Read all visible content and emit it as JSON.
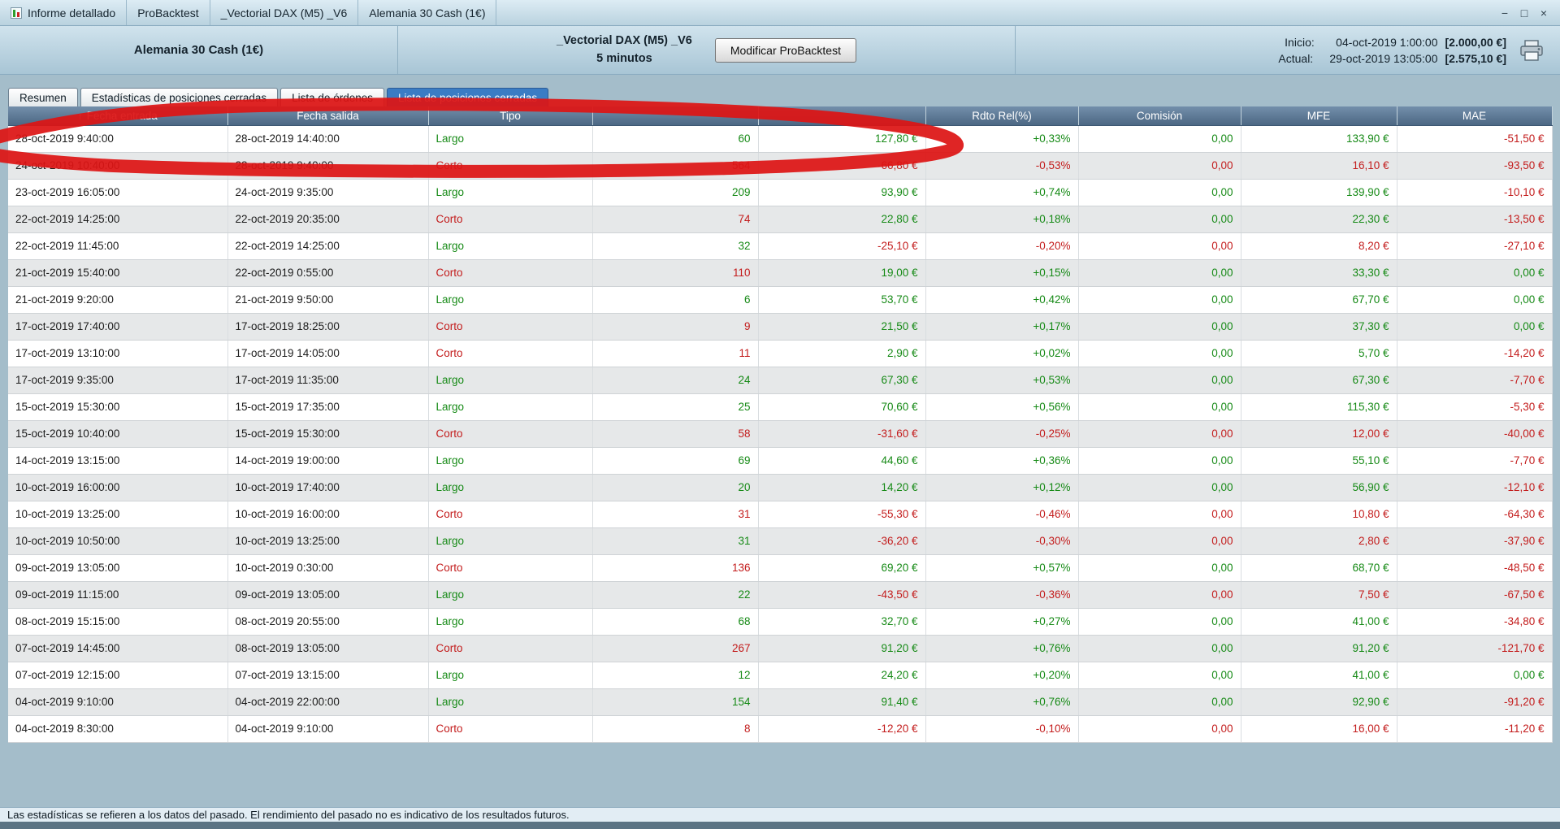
{
  "titlebar": {
    "segments": [
      "Informe detallado",
      "ProBacktest",
      "_Vectorial DAX (M5) _V6",
      "Alemania 30 Cash (1€)"
    ]
  },
  "icons": {
    "minimize": "−",
    "maximize": "□",
    "close": "×",
    "sort": "↑"
  },
  "header": {
    "instrument": "Alemania 30 Cash (1€)",
    "system": "_Vectorial DAX (M5) _V6",
    "timeframe": "5 minutos",
    "modify_button": "Modificar ProBacktest",
    "start_label": "Inicio:",
    "start_datetime": "04-oct-2019 1:00:00",
    "start_equity": "[2.000,00 €]",
    "current_label": "Actual:",
    "current_datetime": "29-oct-2019 13:05:00",
    "current_equity": "[2.575,10 €]"
  },
  "tabs": [
    {
      "label": "Resumen",
      "active": false
    },
    {
      "label": "Estadísticas de posiciones cerradas",
      "active": false
    },
    {
      "label": "Lista de órdenes",
      "active": false
    },
    {
      "label": "Lista de posiciones cerradas",
      "active": true
    }
  ],
  "table": {
    "columns": [
      "Fecha entrada",
      "Fecha salida",
      "Tipo",
      "",
      "",
      "Rdto Rel(%)",
      "Comisión",
      "MFE",
      "MAE"
    ],
    "rows": [
      [
        "28-oct-2019 9:40:00",
        "28-oct-2019 14:40:00",
        "Largo",
        "60",
        "127,80 €",
        "+0,33%",
        "0,00",
        "133,90 €",
        "-51,50 €"
      ],
      [
        "24-oct-2019 10:40:00",
        "28-oct-2019 9:40:00",
        "Corto",
        "564",
        "-66,80 €",
        "-0,53%",
        "0,00",
        "16,10 €",
        "-93,50 €"
      ],
      [
        "23-oct-2019 16:05:00",
        "24-oct-2019 9:35:00",
        "Largo",
        "209",
        "93,90 €",
        "+0,74%",
        "0,00",
        "139,90 €",
        "-10,10 €"
      ],
      [
        "22-oct-2019 14:25:00",
        "22-oct-2019 20:35:00",
        "Corto",
        "74",
        "22,80 €",
        "+0,18%",
        "0,00",
        "22,30 €",
        "-13,50 €"
      ],
      [
        "22-oct-2019 11:45:00",
        "22-oct-2019 14:25:00",
        "Largo",
        "32",
        "-25,10 €",
        "-0,20%",
        "0,00",
        "8,20 €",
        "-27,10 €"
      ],
      [
        "21-oct-2019 15:40:00",
        "22-oct-2019 0:55:00",
        "Corto",
        "110",
        "19,00 €",
        "+0,15%",
        "0,00",
        "33,30 €",
        "0,00 €"
      ],
      [
        "21-oct-2019 9:20:00",
        "21-oct-2019 9:50:00",
        "Largo",
        "6",
        "53,70 €",
        "+0,42%",
        "0,00",
        "67,70 €",
        "0,00 €"
      ],
      [
        "17-oct-2019 17:40:00",
        "17-oct-2019 18:25:00",
        "Corto",
        "9",
        "21,50 €",
        "+0,17%",
        "0,00",
        "37,30 €",
        "0,00 €"
      ],
      [
        "17-oct-2019 13:10:00",
        "17-oct-2019 14:05:00",
        "Corto",
        "11",
        "2,90 €",
        "+0,02%",
        "0,00",
        "5,70 €",
        "-14,20 €"
      ],
      [
        "17-oct-2019 9:35:00",
        "17-oct-2019 11:35:00",
        "Largo",
        "24",
        "67,30 €",
        "+0,53%",
        "0,00",
        "67,30 €",
        "-7,70 €"
      ],
      [
        "15-oct-2019 15:30:00",
        "15-oct-2019 17:35:00",
        "Largo",
        "25",
        "70,60 €",
        "+0,56%",
        "0,00",
        "115,30 €",
        "-5,30 €"
      ],
      [
        "15-oct-2019 10:40:00",
        "15-oct-2019 15:30:00",
        "Corto",
        "58",
        "-31,60 €",
        "-0,25%",
        "0,00",
        "12,00 €",
        "-40,00 €"
      ],
      [
        "14-oct-2019 13:15:00",
        "14-oct-2019 19:00:00",
        "Largo",
        "69",
        "44,60 €",
        "+0,36%",
        "0,00",
        "55,10 €",
        "-7,70 €"
      ],
      [
        "10-oct-2019 16:00:00",
        "10-oct-2019 17:40:00",
        "Largo",
        "20",
        "14,20 €",
        "+0,12%",
        "0,00",
        "56,90 €",
        "-12,10 €"
      ],
      [
        "10-oct-2019 13:25:00",
        "10-oct-2019 16:00:00",
        "Corto",
        "31",
        "-55,30 €",
        "-0,46%",
        "0,00",
        "10,80 €",
        "-64,30 €"
      ],
      [
        "10-oct-2019 10:50:00",
        "10-oct-2019 13:25:00",
        "Largo",
        "31",
        "-36,20 €",
        "-0,30%",
        "0,00",
        "2,80 €",
        "-37,90 €"
      ],
      [
        "09-oct-2019 13:05:00",
        "10-oct-2019 0:30:00",
        "Corto",
        "136",
        "69,20 €",
        "+0,57%",
        "0,00",
        "68,70 €",
        "-48,50 €"
      ],
      [
        "09-oct-2019 11:15:00",
        "09-oct-2019 13:05:00",
        "Largo",
        "22",
        "-43,50 €",
        "-0,36%",
        "0,00",
        "7,50 €",
        "-67,50 €"
      ],
      [
        "08-oct-2019 15:15:00",
        "08-oct-2019 20:55:00",
        "Largo",
        "68",
        "32,70 €",
        "+0,27%",
        "0,00",
        "41,00 €",
        "-34,80 €"
      ],
      [
        "07-oct-2019 14:45:00",
        "08-oct-2019 13:05:00",
        "Corto",
        "267",
        "91,20 €",
        "+0,76%",
        "0,00",
        "91,20 €",
        "-121,70 €"
      ],
      [
        "07-oct-2019 12:15:00",
        "07-oct-2019 13:15:00",
        "Largo",
        "12",
        "24,20 €",
        "+0,20%",
        "0,00",
        "41,00 €",
        "0,00 €"
      ],
      [
        "04-oct-2019 9:10:00",
        "04-oct-2019 22:00:00",
        "Largo",
        "154",
        "91,40 €",
        "+0,76%",
        "0,00",
        "92,90 €",
        "-91,20 €"
      ],
      [
        "04-oct-2019 8:30:00",
        "04-oct-2019 9:10:00",
        "Corto",
        "8",
        "-12,20 €",
        "-0,10%",
        "0,00",
        "16,00 €",
        "-11,20 €"
      ]
    ]
  },
  "footer": {
    "disclaimer": "Las estadísticas se refieren a los datos del pasado. El rendimiento del pasado no es indicativo de los resultados futuros."
  },
  "colors": {
    "positive": "#168a16",
    "negative": "#c31c1c",
    "active_tab": "#3a7cc4",
    "annotation": "#dd1414"
  }
}
